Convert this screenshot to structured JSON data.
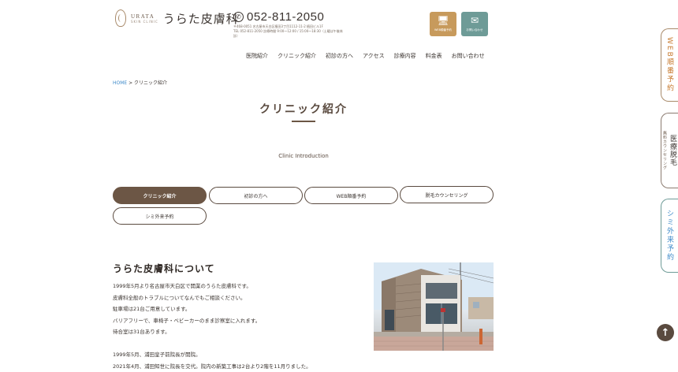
{
  "header": {
    "logo_en": "URATA",
    "logo_sub": "SKIN CLINIC",
    "logo_jp": "うらた皮膚科",
    "phone": "052-811-2050",
    "address_lines": [
      "〒468-0051 名古屋市天白区植田3丁目1112-11-2 植田ビル1F",
      "TEL 052-811-2050 診療時間 9:00〜12:00 / 15:00〜18:30（土曜は午後休診）"
    ],
    "web_button_label": "WEB順番予約",
    "contact_button_label": "お問い合わせ"
  },
  "nav": [
    "医院紹介",
    "クリニック紹介",
    "初診の方へ",
    "アクセス",
    "診療内容",
    "料金表",
    "お問い合わせ"
  ],
  "side_tabs": {
    "web": "WEB順番予約",
    "hair_big": "医療脱毛",
    "hair_small": "無料カウンセリング",
    "shimi": "シミ外来予約"
  },
  "breadcrumb": {
    "home": "HOME",
    "separator": " > ",
    "current": "クリニック紹介"
  },
  "page": {
    "title": "クリニック紹介",
    "subtitle_en": "Clinic Introduction"
  },
  "tabs": [
    "クリニック紹介",
    "初診の方へ",
    "WEB順番予約",
    "脱毛カウンセリング",
    "シミ外来予約"
  ],
  "section": {
    "title": "うらた皮膚科について",
    "paragraph1": [
      "1999年5月より名古屋市天白区で開業のうらた皮膚科です。",
      "皮膚科全般のトラブルについてなんでもご相談ください。",
      "駐車場は21台ご用意しています。",
      "バリアフリーで、車椅子・ベビーカーのまま診察室に入れます。",
      "待合室は31台あります。"
    ],
    "paragraph2": [
      "1999年5月、浦田皇子前院長が開院。",
      "2021年4月、浦田知世に院長を交代。院内の新築工事は2台より2階を11月りました。"
    ]
  }
}
